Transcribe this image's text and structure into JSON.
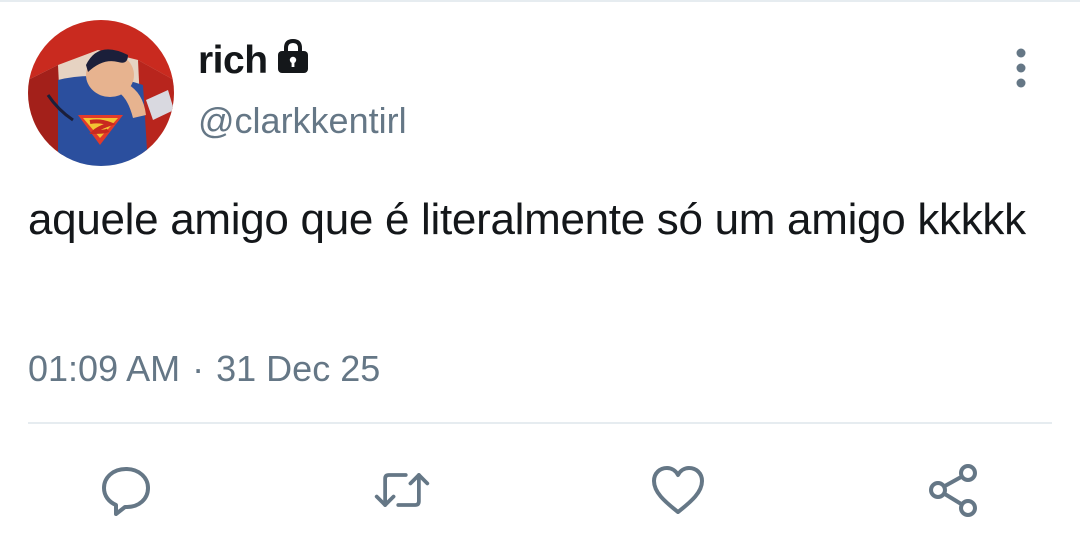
{
  "profile": {
    "display_name": "rich",
    "handle": "@clarkkentirl",
    "protected_icon": "lock-icon",
    "avatar_icon": "superman-avatar"
  },
  "tweet": {
    "text": "aquele amigo que é literalmente só um amigo kkkkk",
    "time": "01:09 AM",
    "separator": "·",
    "date": "31 Dec 25"
  },
  "actions": [
    {
      "name": "reply",
      "icon": "comment-icon"
    },
    {
      "name": "retweet",
      "icon": "retweet-icon"
    },
    {
      "name": "like",
      "icon": "heart-icon"
    },
    {
      "name": "share",
      "icon": "share-icon"
    }
  ],
  "menu": {
    "icon": "more-vertical-icon"
  },
  "colors": {
    "text": "#14171a",
    "secondary": "#657786",
    "divider": "#e6ecf0"
  }
}
